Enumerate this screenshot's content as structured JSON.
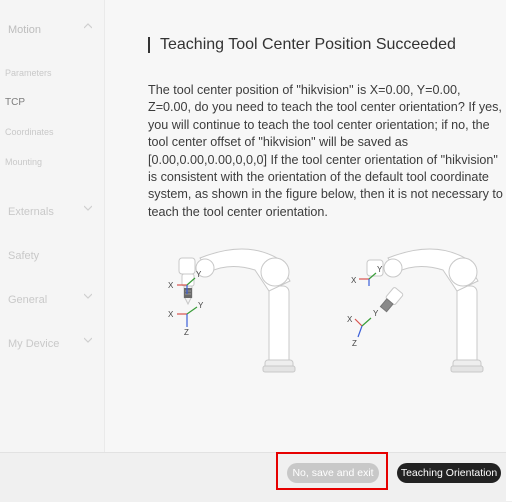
{
  "sidebar": {
    "motion": "Motion",
    "parameters": "Parameters",
    "tcp": "TCP",
    "coordinates": "Coordinates",
    "mounting": "Mounting",
    "externals": "Externals",
    "safety": "Safety",
    "general": "General",
    "my_device": "My Device"
  },
  "dialog": {
    "title": "Teaching Tool Center Position Succeeded",
    "body": "The tool center position of \"hikvision\" is X=0.00, Y=0.00, Z=0.00, do you need to teach the tool center orientation? If yes, you will continue to teach the tool center orientation; if no, the tool center offset of \"hikvision\" will be saved as [0.00,0.00,0.00,0,0,0] If the tool center orientation of \"hikvision\" is consistent with the orientation of the default tool coordinate system, as shown in the figure below, then it is not necessary to teach the tool center orientation.",
    "figure": {
      "left": {
        "x_top": "X",
        "y_top": "Y",
        "x_bot": "X",
        "y_bot": "Y",
        "z_bot": "Z"
      },
      "right": {
        "x_top": "X",
        "y_top": "Y",
        "x_bot": "X",
        "y_bot": "Y",
        "z_bot": "Z"
      }
    }
  },
  "footer": {
    "no_save_exit": "No, save and exit",
    "teach_orientation": "Teaching Orientation"
  },
  "colors": {
    "accent_highlight": "#e60000",
    "axis_red": "#d9534f",
    "axis_green": "#3a9d3a",
    "axis_blue": "#3b5fd9"
  }
}
